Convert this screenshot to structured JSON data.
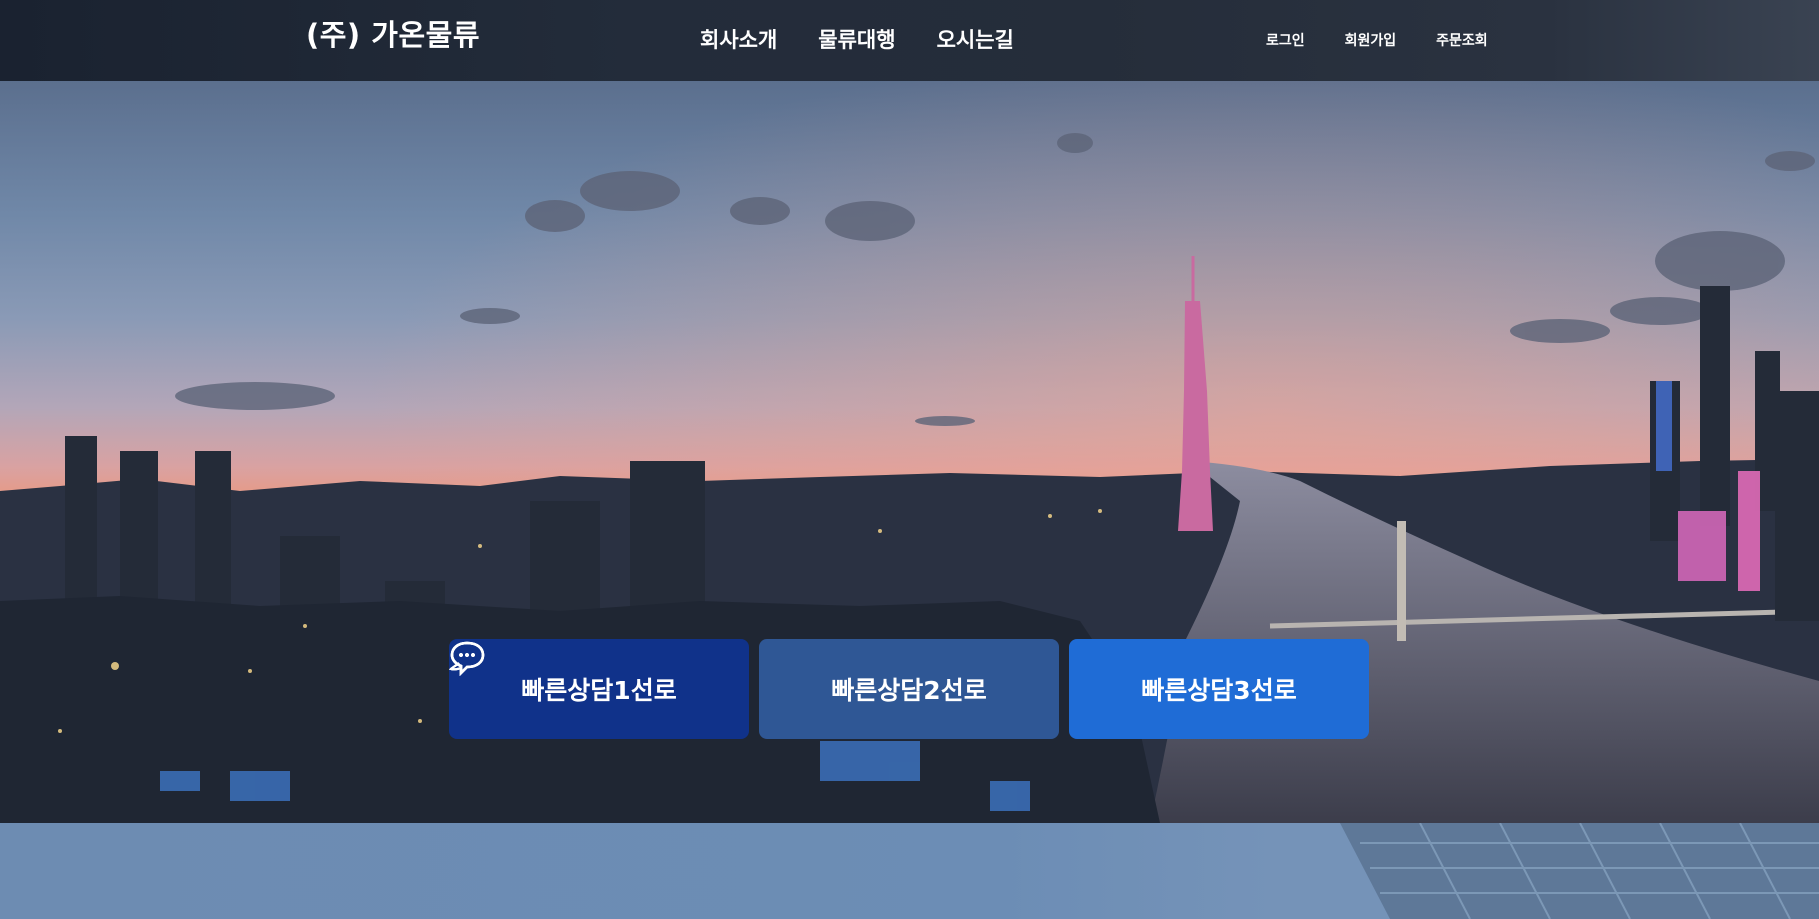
{
  "header": {
    "logo": "(주) 가온물류",
    "main_nav": [
      "회사소개",
      "물류대행",
      "오시는길"
    ],
    "util_nav": [
      "로그인",
      "회원가입",
      "주문조회"
    ]
  },
  "hero": {
    "consult_buttons": [
      {
        "label": "빠른상담1선로",
        "color": "#10328a",
        "icon": "chat-bubbles-icon"
      },
      {
        "label": "빠른상담2선로",
        "color": "#2f5795",
        "icon": "chat-bubbles-icon"
      },
      {
        "label": "빠른상담3선로",
        "color": "#1f6cd6",
        "icon": "chat-bubbles-icon"
      }
    ]
  }
}
